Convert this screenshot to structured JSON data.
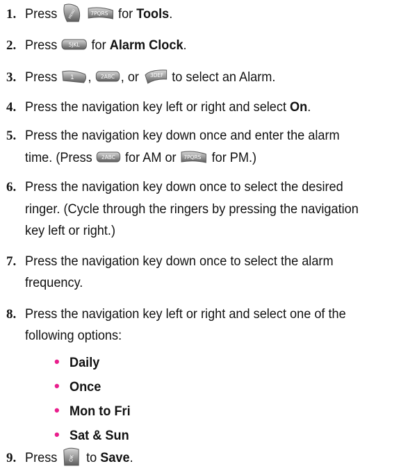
{
  "steps": [
    {
      "num": "1.",
      "pre": "Press",
      "mid": "for",
      "bold": "Tools",
      "post": "."
    },
    {
      "num": "2.",
      "pre": "Press",
      "mid": "for",
      "bold": "Alarm Clock",
      "post": "."
    },
    {
      "num": "3.",
      "pre": "Press",
      "sep1": ",",
      "sep2": ", or",
      "post": "to select an Alarm."
    },
    {
      "num": "4.",
      "pre": "Press the navigation key left or right and select",
      "bold": "On",
      "post": "."
    },
    {
      "num": "5.",
      "line1": "Press the navigation key down once and enter the alarm",
      "line2_pre": "time. (Press",
      "line2_mid": "for AM or",
      "line2_post": "for PM.)"
    },
    {
      "num": "6.",
      "line1": "Press the navigation key down once to select the desired",
      "line2": "ringer. (Cycle through the ringers by pressing the navigation",
      "line3": "key left or right.)"
    },
    {
      "num": "7.",
      "line1": "Press the navigation key down once to select the alarm",
      "line2": "frequency."
    },
    {
      "num": "8.",
      "line1": "Press the navigation key left or right and select one of the",
      "line2": "following options:"
    },
    {
      "num": "9.",
      "pre": "Press",
      "mid": "to",
      "bold": "Save",
      "post": "."
    }
  ],
  "options": [
    "Daily",
    "Once",
    "Mon to Fri",
    "Sat & Sun"
  ],
  "keys": {
    "menu": "MENU",
    "k7": "7PQRS",
    "k5": "5JKL",
    "k1": "1",
    "k2": "2ABC",
    "k3": "3DEF",
    "ok": "OK"
  },
  "colors": {
    "bullet": "#e91e8c",
    "key_body": "#9a9a9a",
    "key_text": "#ffffff"
  }
}
